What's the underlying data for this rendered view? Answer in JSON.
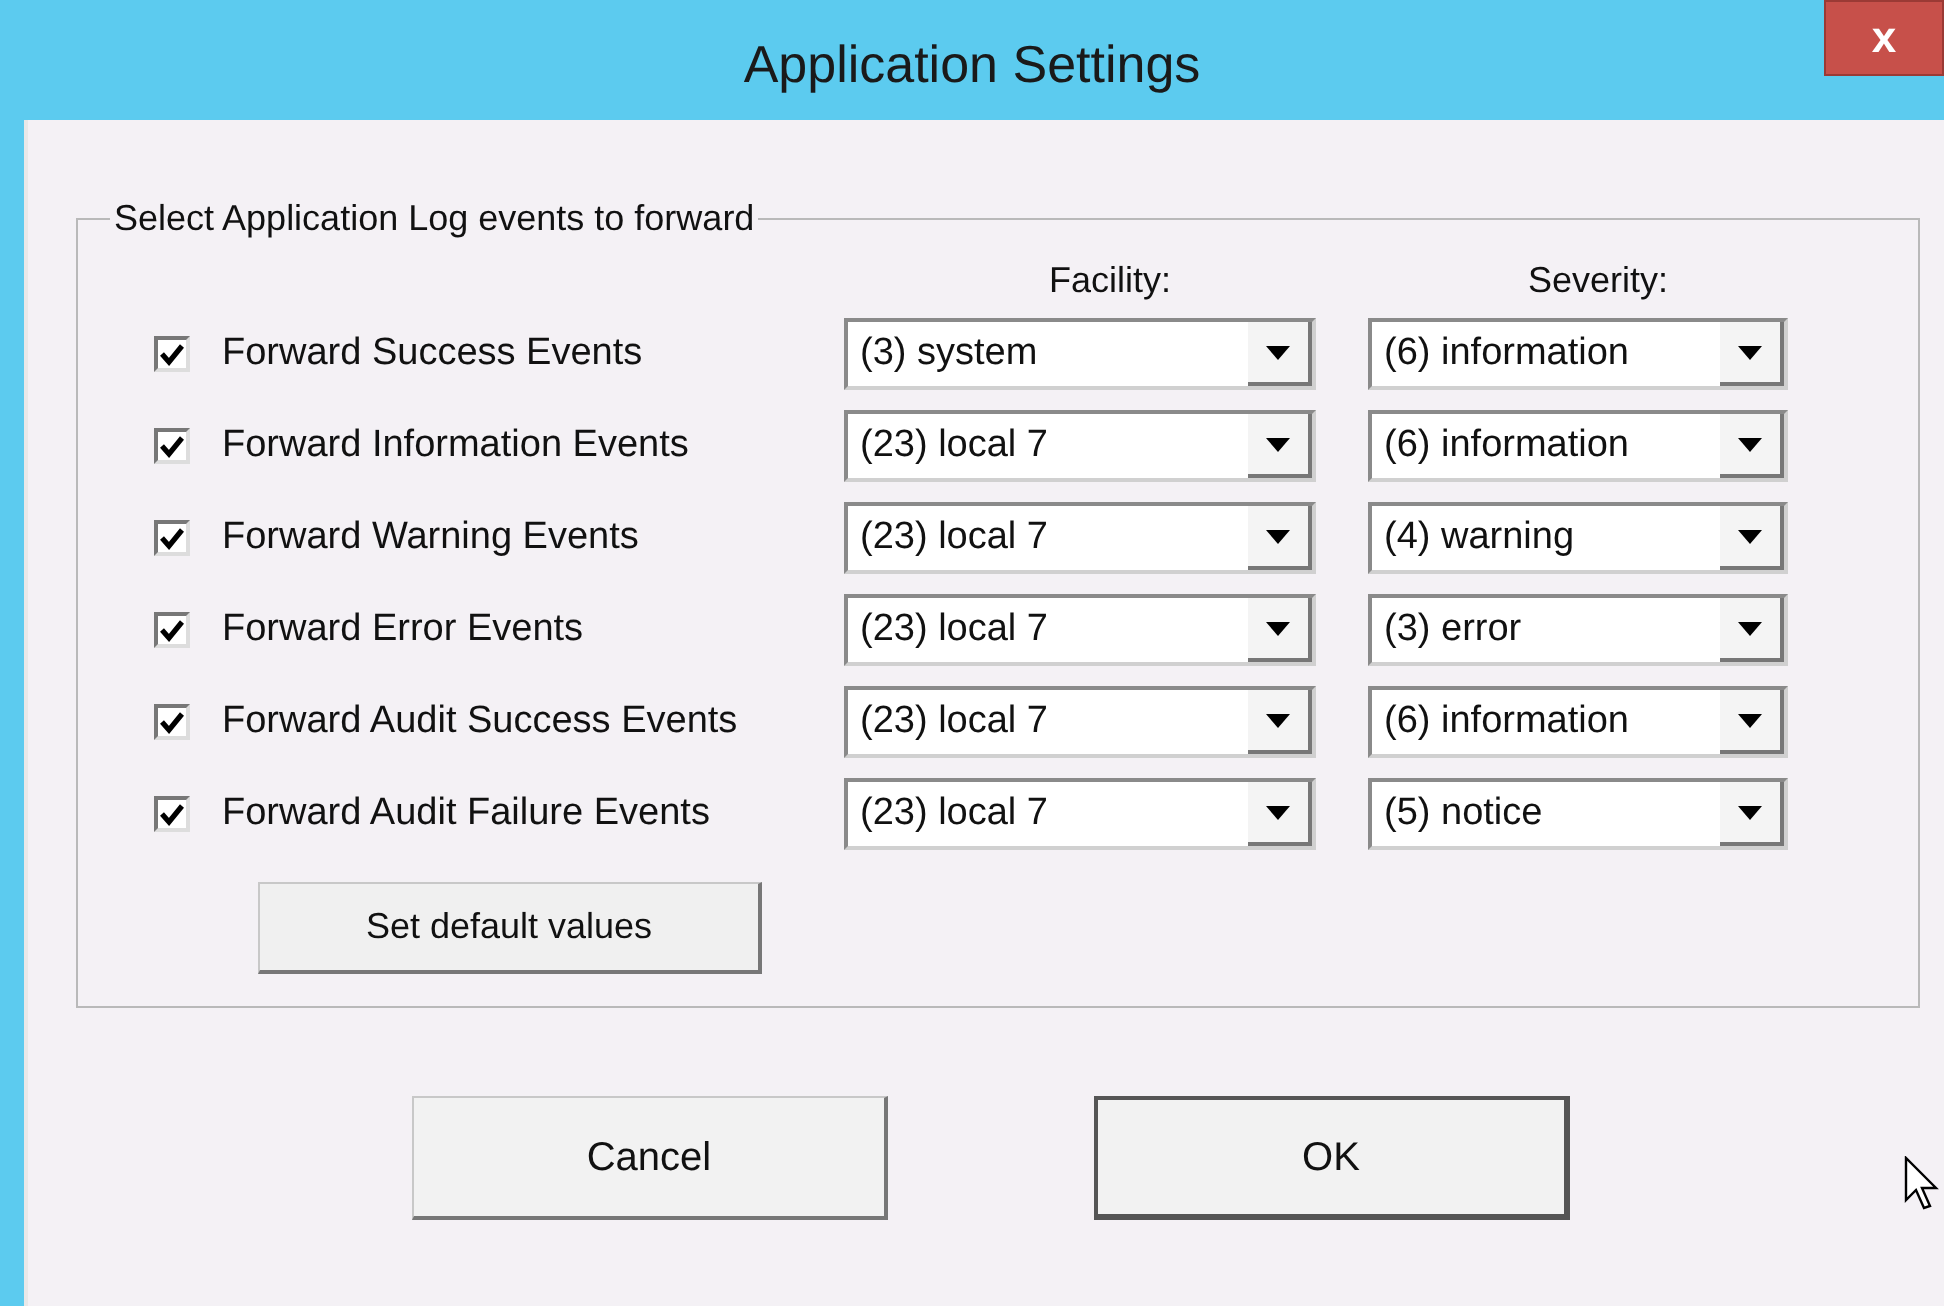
{
  "window": {
    "title": "Application Settings",
    "close": "x"
  },
  "group": {
    "legend": "Select Application Log events to forward",
    "columns": [
      "Facility:",
      "Severity:"
    ],
    "rows": [
      {
        "label": "Forward Success Events",
        "checked": true,
        "facility": "(3) system",
        "severity": "(6) information"
      },
      {
        "label": "Forward Information Events",
        "checked": true,
        "facility": "(23) local 7",
        "severity": "(6) information"
      },
      {
        "label": "Forward Warning Events",
        "checked": true,
        "facility": "(23) local 7",
        "severity": "(4) warning"
      },
      {
        "label": "Forward Error Events",
        "checked": true,
        "facility": "(23) local 7",
        "severity": "(3) error"
      },
      {
        "label": "Forward Audit Success Events",
        "checked": true,
        "facility": "(23) local 7",
        "severity": "(6) information"
      },
      {
        "label": "Forward Audit Failure Events",
        "checked": true,
        "facility": "(23) local 7",
        "severity": "(5) notice"
      }
    ],
    "default_button": "Set default values"
  },
  "buttons": [
    {
      "label": "Cancel",
      "default": false
    },
    {
      "label": "OK",
      "default": true
    }
  ]
}
